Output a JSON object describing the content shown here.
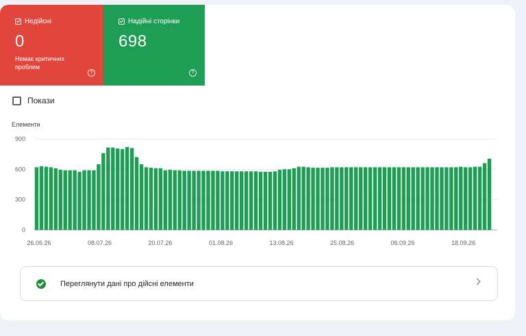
{
  "tiles": {
    "invalid": {
      "label": "Недійсні",
      "value": "0",
      "sub": "Немає критичних проблем",
      "color": "#e0463b"
    },
    "valid": {
      "label": "Надійні сторінки",
      "value": "698",
      "color": "#1e9e55"
    }
  },
  "show_label": "Покази",
  "chart_data": {
    "type": "bar",
    "ylabel": "Елементи",
    "ylim": [
      0,
      900
    ],
    "yticks": [
      "900",
      "600",
      "300",
      "0"
    ],
    "xticks": [
      "26.06.26",
      "08.07.26",
      "20.07.26",
      "01.08.26",
      "13.08.26",
      "25.08.26",
      "06.09.26",
      "18.09.26"
    ],
    "bar_color": "#1e9e55",
    "values": [
      620,
      630,
      625,
      620,
      610,
      595,
      590,
      590,
      590,
      575,
      590,
      590,
      590,
      650,
      760,
      815,
      815,
      805,
      800,
      820,
      810,
      720,
      650,
      620,
      615,
      610,
      610,
      590,
      595,
      590,
      590,
      585,
      585,
      585,
      585,
      585,
      585,
      585,
      585,
      580,
      580,
      580,
      580,
      580,
      580,
      580,
      580,
      575,
      575,
      575,
      580,
      595,
      600,
      600,
      610,
      625,
      625,
      620,
      615,
      615,
      615,
      615,
      620,
      620,
      620,
      620,
      620,
      620,
      620,
      620,
      620,
      620,
      620,
      620,
      620,
      620,
      620,
      620,
      620,
      620,
      620,
      620,
      620,
      620,
      620,
      620,
      620,
      620,
      620,
      625,
      620,
      620,
      625,
      625,
      660,
      705
    ]
  },
  "link_text": "Переглянути дані про дійсні елементи"
}
